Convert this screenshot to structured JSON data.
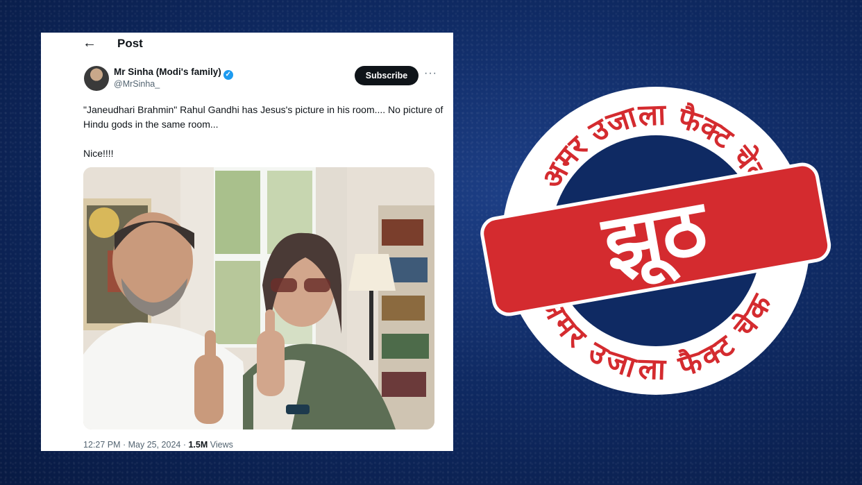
{
  "post": {
    "header_title": "Post",
    "back_icon": "arrow-left-icon",
    "author_name": "Mr Sinha (Modi's family)",
    "author_handle": "@MrSinha_",
    "verified_icon": "verified-badge-icon",
    "subscribe_label": "Subscribe",
    "more_icon": "more-horizontal-icon",
    "text_line1": "\"Janeudhari Brahmin\" Rahul Gandhi has Jesus's picture in his room.... No picture of Hindu gods in the same room...",
    "text_line2": "Nice!!!!",
    "time": "12:27 PM · May 25, 2024 · ",
    "views_count": "1.5M",
    "views_label": " Views"
  },
  "stamp": {
    "ring_text_top": "अमर उजाला फैक्ट चेक",
    "ring_text_bottom": "अमर उजाला फैक्ट चेक",
    "verdict": "झूठ",
    "accent_color": "#d42b2f",
    "ring_color": "#ffffff"
  }
}
